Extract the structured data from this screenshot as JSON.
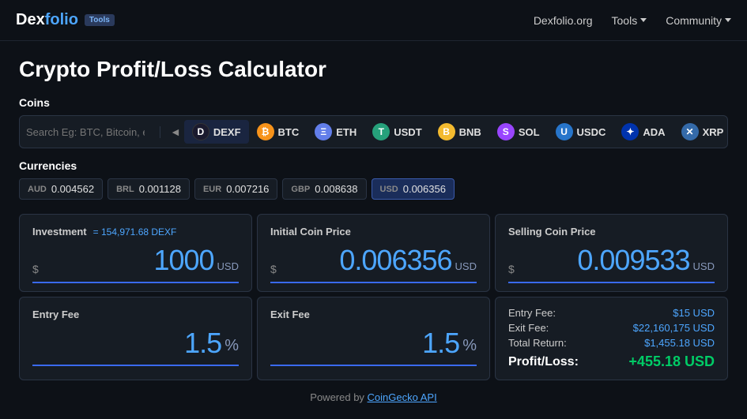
{
  "navbar": {
    "logo": "Dexfolio",
    "logo_highlight": "folio",
    "tools_badge": "Tools",
    "links": [
      {
        "label": "Dexfolio.org",
        "has_dropdown": false
      },
      {
        "label": "Tools",
        "has_dropdown": true
      },
      {
        "label": "Community",
        "has_dropdown": true
      }
    ]
  },
  "page": {
    "title": "Crypto Profit/Loss Calculator"
  },
  "coins_section": {
    "label": "Coins",
    "search_placeholder": "Search Eg: BTC, Bitcoin, etc.",
    "coins": [
      {
        "id": "dexf",
        "symbol": "DEXF",
        "icon_class": "icon-dexf",
        "icon_text": "D",
        "active": true
      },
      {
        "id": "btc",
        "symbol": "BTC",
        "icon_class": "icon-btc",
        "icon_text": "₿",
        "active": false
      },
      {
        "id": "eth",
        "symbol": "ETH",
        "icon_class": "icon-eth",
        "icon_text": "Ξ",
        "active": false
      },
      {
        "id": "usdt",
        "symbol": "USDT",
        "icon_class": "icon-usdt",
        "icon_text": "T",
        "active": false
      },
      {
        "id": "bnb",
        "symbol": "BNB",
        "icon_class": "icon-bnb",
        "icon_text": "B",
        "active": false
      },
      {
        "id": "sol",
        "symbol": "SOL",
        "icon_class": "icon-sol",
        "icon_text": "S",
        "active": false
      },
      {
        "id": "usdc",
        "symbol": "USDC",
        "icon_class": "icon-usdc",
        "icon_text": "U",
        "active": false
      },
      {
        "id": "ada",
        "symbol": "ADA",
        "icon_class": "icon-ada",
        "icon_text": "✦",
        "active": false
      },
      {
        "id": "xrp",
        "symbol": "XRP",
        "icon_class": "icon-xrp",
        "icon_text": "✕",
        "active": false
      }
    ]
  },
  "currencies_section": {
    "label": "Currencies",
    "currencies": [
      {
        "code": "AUD",
        "value": "0.004562",
        "active": false
      },
      {
        "code": "BRL",
        "value": "0.001128",
        "active": false
      },
      {
        "code": "EUR",
        "value": "0.007216",
        "active": false
      },
      {
        "code": "GBP",
        "value": "0.008638",
        "active": false
      },
      {
        "code": "USD",
        "value": "0.006356",
        "active": true
      }
    ]
  },
  "calculator": {
    "investment": {
      "title": "Investment",
      "coin_equiv": "= 154,971.68 DEXF",
      "dollar_sign": "$",
      "value": "1000",
      "unit": "USD"
    },
    "initial_price": {
      "title": "Initial Coin Price",
      "dollar_sign": "$",
      "value": "0.006356",
      "unit": "USD"
    },
    "selling_price": {
      "title": "Selling Coin Price",
      "dollar_sign": "$",
      "value": "0.009533",
      "unit": "USD"
    },
    "entry_fee": {
      "title": "Entry Fee",
      "value": "1.5",
      "unit": "%"
    },
    "exit_fee": {
      "title": "Exit Fee",
      "value": "1.5",
      "unit": "%"
    },
    "results": {
      "entry_fee_label": "Entry Fee:",
      "entry_fee_value": "$15 USD",
      "exit_fee_label": "Exit Fee:",
      "exit_fee_value": "$22,160,175 USD",
      "total_return_label": "Total Return:",
      "total_return_value": "$1,455.18 USD",
      "profit_label": "Profit/Loss:",
      "profit_value": "+455.18 USD"
    }
  },
  "footer": {
    "text": "Powered by ",
    "link_text": "CoinGecko API"
  }
}
